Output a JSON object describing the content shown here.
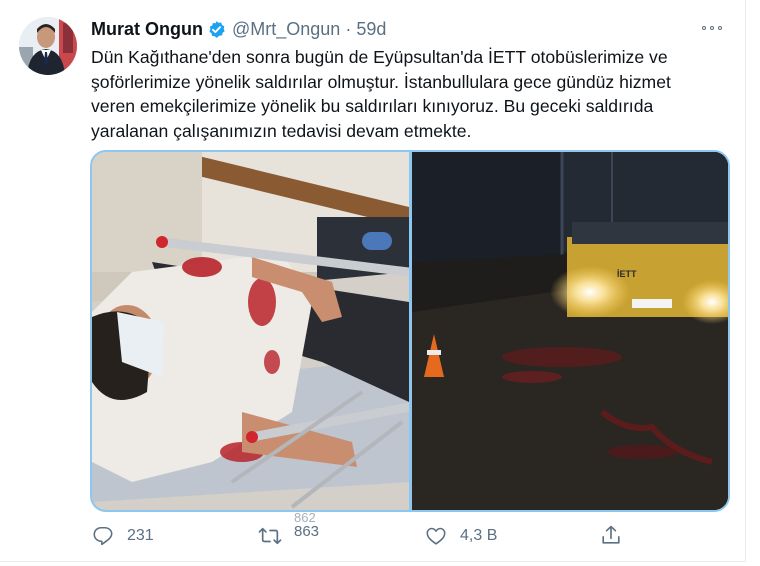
{
  "tweet": {
    "author_name": "Murat Ongun",
    "handle": "@Mrt_Ongun",
    "separator": "·",
    "age": "59d",
    "text_lines": [
      "Dün Kağıthane'den sonra bugün de Eyüpsultan'da İETT otobüslerimize ve",
      "şoförlerimize yönelik saldırılar olmuştur. İstanbullulara gece gündüz hizmet",
      "veren emekçilerimize yönelik bu saldırıları kınıyoruz. Bu geceki saldırıda",
      "yaralanan çalışanımızın tedavisi devam etmekte."
    ],
    "bus_label": "İETT"
  },
  "actions": {
    "reply_count": "231",
    "retweet_count_prev": "862",
    "retweet_count": "863",
    "like_count": "4,3 B"
  },
  "colors": {
    "verified": "#1da1f2",
    "secondary_text": "#5b7083",
    "media_border": "#8dc6ee"
  },
  "icons": {
    "verified": "verified-badge-icon",
    "more": "more-dots-icon",
    "reply": "reply-icon",
    "retweet": "retweet-icon",
    "like": "heart-icon",
    "share": "share-icon"
  }
}
